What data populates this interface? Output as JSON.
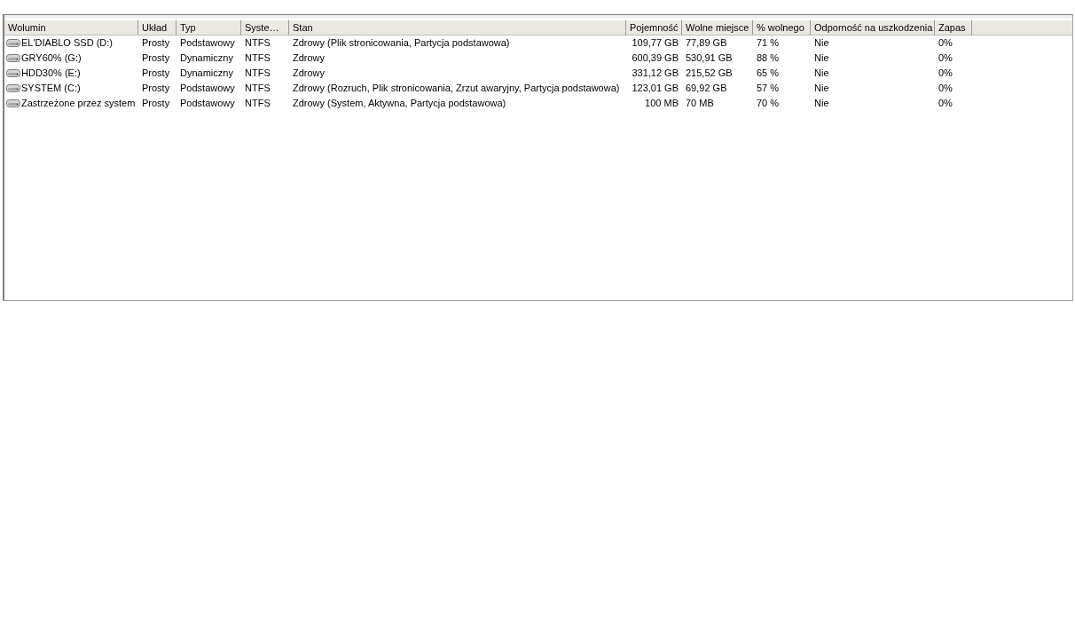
{
  "table": {
    "columns": [
      {
        "label": "Wolumin"
      },
      {
        "label": "Układ"
      },
      {
        "label": "Typ"
      },
      {
        "label": "Syste…"
      },
      {
        "label": "Stan"
      },
      {
        "label": "Pojemność"
      },
      {
        "label": "Wolne miejsce"
      },
      {
        "label": "% wolnego"
      },
      {
        "label": "Odporność na uszkodzenia"
      },
      {
        "label": "Zapas"
      }
    ],
    "rows": [
      {
        "cells": [
          "EL'DIABLO SSD (D:)",
          "Prosty",
          "Podstawowy",
          "NTFS",
          "Zdrowy (Plik stronicowania, Partycja podstawowa)",
          "109,77 GB",
          "77,89 GB",
          "71 %",
          "Nie",
          "0%"
        ]
      },
      {
        "cells": [
          "GRY60% (G:)",
          "Prosty",
          "Dynamiczny",
          "NTFS",
          "Zdrowy",
          "600,39 GB",
          "530,91 GB",
          "88 %",
          "Nie",
          "0%"
        ]
      },
      {
        "cells": [
          "HDD30% (E:)",
          "Prosty",
          "Dynamiczny",
          "NTFS",
          "Zdrowy",
          "331,12 GB",
          "215,52 GB",
          "65 %",
          "Nie",
          "0%"
        ]
      },
      {
        "cells": [
          "SYSTEM (C:)",
          "Prosty",
          "Podstawowy",
          "NTFS",
          "Zdrowy (Rozruch, Plik stronicowania, Zrzut awaryjny, Partycja podstawowa)",
          "123,01 GB",
          "69,92 GB",
          "57 %",
          "Nie",
          "0%"
        ]
      },
      {
        "cells": [
          "Zastrzeżone przez system",
          "Prosty",
          "Podstawowy",
          "NTFS",
          "Zdrowy (System, Aktywna, Partycja podstawowa)",
          "100 MB",
          "70 MB",
          "70 %",
          "Nie",
          "0%"
        ]
      }
    ]
  }
}
